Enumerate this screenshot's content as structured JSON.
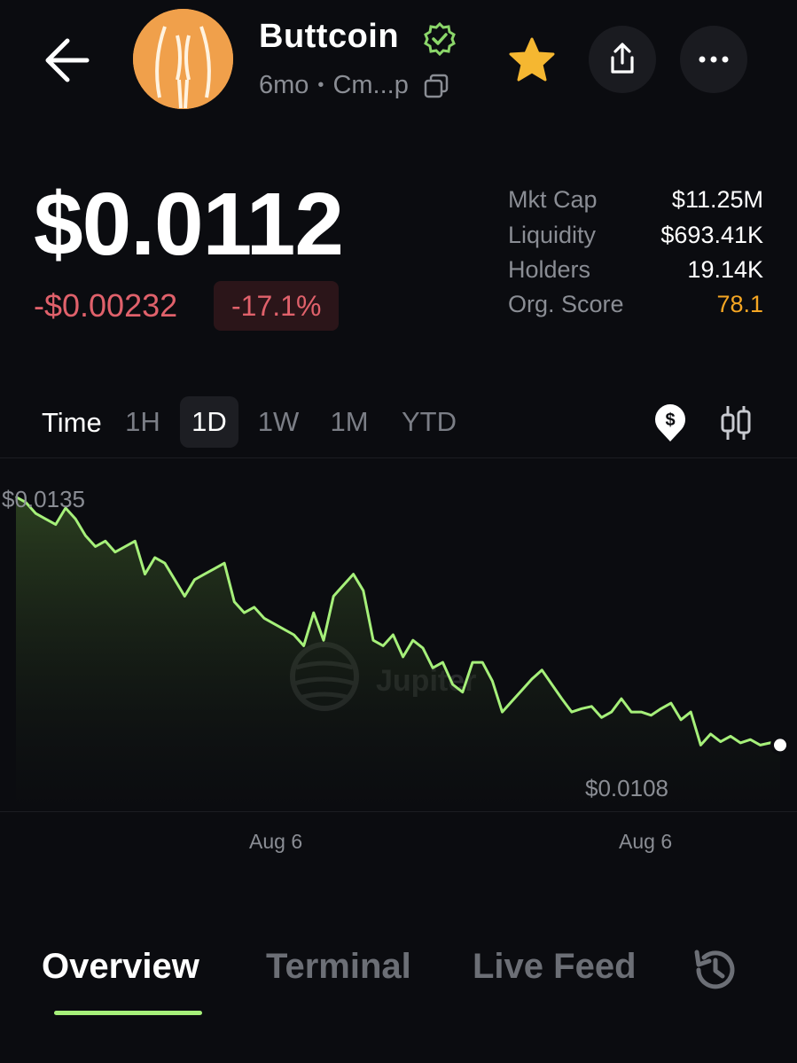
{
  "header": {
    "token_name": "Buttcoin",
    "age": "6mo",
    "separator": "•",
    "address_short": "Cm...p",
    "icons": [
      "back-arrow-icon",
      "verified-badge-icon",
      "copy-icon",
      "star-icon",
      "share-icon",
      "more-icon"
    ],
    "colors": {
      "avatar": "#f0a04b",
      "star": "#f5b731",
      "verified": "#8bd66a"
    }
  },
  "price": {
    "value": "$0.0112",
    "change_abs": "-$0.00232",
    "change_pct": "-17.1%"
  },
  "stats": [
    {
      "label": "Mkt Cap",
      "value": "$11.25M"
    },
    {
      "label": "Liquidity",
      "value": "$693.41K"
    },
    {
      "label": "Holders",
      "value": "19.14K"
    },
    {
      "label": "Org. Score",
      "value": "78.1"
    }
  ],
  "timeframe": {
    "label": "Time",
    "options": [
      "1H",
      "1D",
      "1W",
      "1M",
      "YTD"
    ],
    "selected": "1D"
  },
  "chart_data": {
    "type": "area",
    "high_label": "$0.0135",
    "low_label": "$0.0108",
    "x_labels": [
      "Aug 6",
      "Aug 6"
    ],
    "ylim": [
      0.0106,
      0.0138
    ],
    "series": [
      {
        "values": [
          0.01345,
          0.0134,
          0.0133,
          0.01325,
          0.0132,
          0.01335,
          0.01325,
          0.0131,
          0.013,
          0.01305,
          0.01295,
          0.013,
          0.01305,
          0.01275,
          0.0129,
          0.01285,
          0.0127,
          0.01255,
          0.0127,
          0.01275,
          0.0128,
          0.01285,
          0.0125,
          0.0124,
          0.01245,
          0.01235,
          0.0123,
          0.01225,
          0.0122,
          0.0121,
          0.0124,
          0.01215,
          0.01255,
          0.01265,
          0.01275,
          0.0126,
          0.01215,
          0.0121,
          0.0122,
          0.012,
          0.01215,
          0.01208,
          0.0119,
          0.01195,
          0.01175,
          0.01168,
          0.01195,
          0.01195,
          0.01178,
          0.0115,
          0.0116,
          0.0117,
          0.0118,
          0.01188,
          0.01175,
          0.01162,
          0.0115,
          0.01153,
          0.01155,
          0.01145,
          0.0115,
          0.01162,
          0.0115,
          0.0115,
          0.01147,
          0.01153,
          0.01158,
          0.01143,
          0.0115,
          0.0112,
          0.0113,
          0.01123,
          0.01128,
          0.01122,
          0.01125,
          0.0112,
          0.01122,
          0.0112
        ],
        "color": "#a6f07a"
      }
    ],
    "watermark": "Jupiter",
    "grid": false
  },
  "tabs": [
    "Overview",
    "Terminal",
    "Live Feed"
  ],
  "active_tab": "Overview"
}
